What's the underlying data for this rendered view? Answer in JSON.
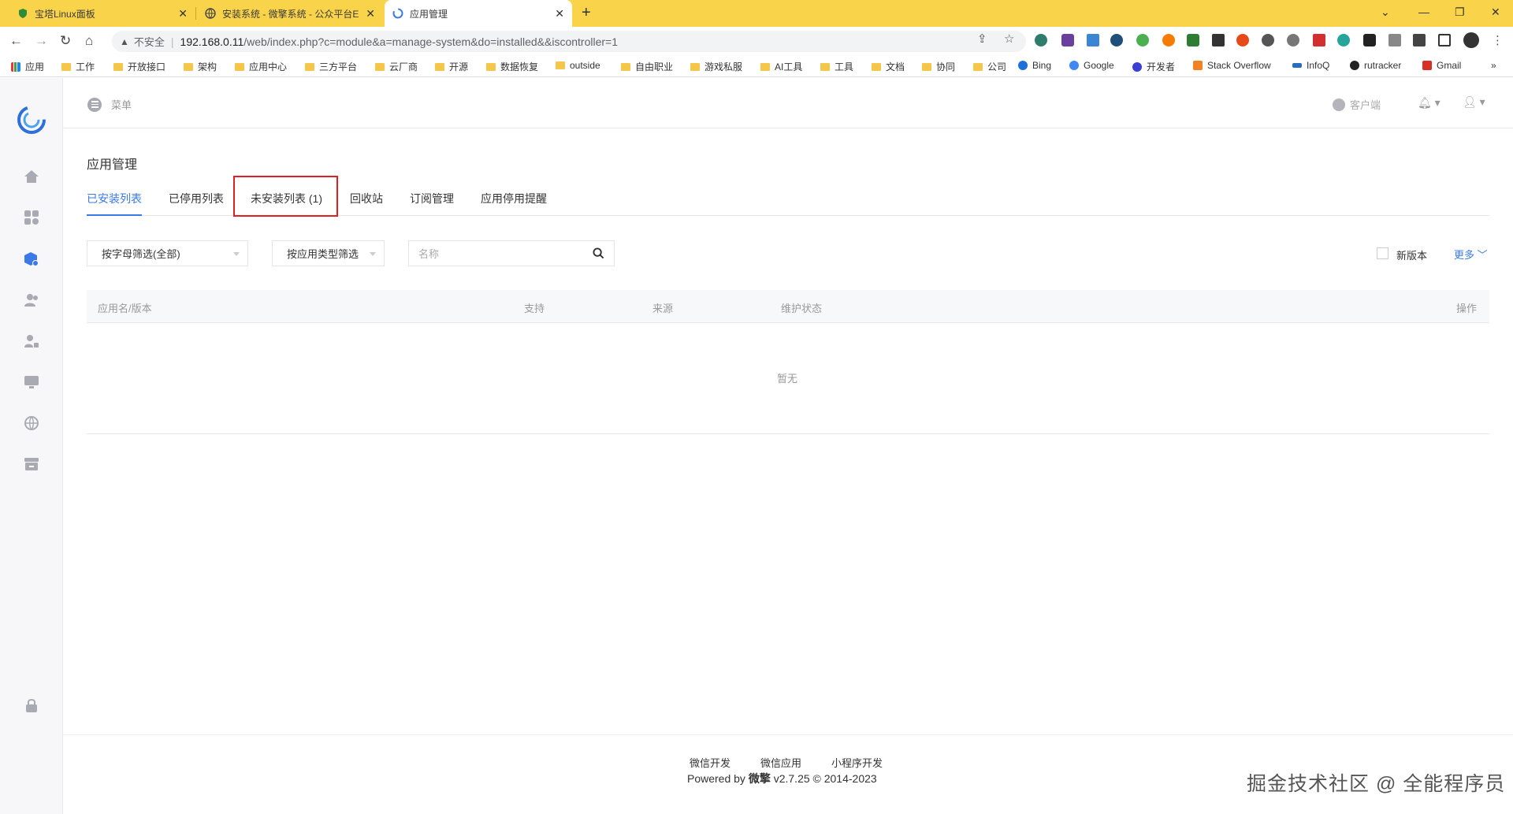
{
  "browser": {
    "tabs": [
      {
        "title": "宝塔Linux面板"
      },
      {
        "title": "安装系统 - 微擎系统 - 公众平台E"
      },
      {
        "title": "应用管理"
      }
    ],
    "address": {
      "insecure_label": "不安全",
      "url_host": "192.168.0.11",
      "url_path": "/web/index.php?c=module&a=manage-system&do=installed&&iscontroller=1"
    },
    "bookmarks": [
      {
        "label": "应用",
        "kind": "apps"
      },
      {
        "label": "工作",
        "kind": "folder"
      },
      {
        "label": "开放接口",
        "kind": "folder"
      },
      {
        "label": "架构",
        "kind": "folder"
      },
      {
        "label": "应用中心",
        "kind": "folder"
      },
      {
        "label": "三方平台",
        "kind": "folder"
      },
      {
        "label": "云厂商",
        "kind": "folder"
      },
      {
        "label": "开源",
        "kind": "folder"
      },
      {
        "label": "数据恢复",
        "kind": "folder"
      },
      {
        "label": "outside",
        "kind": "folder"
      },
      {
        "label": "自由职业",
        "kind": "folder"
      },
      {
        "label": "游戏私服",
        "kind": "folder"
      },
      {
        "label": "AI工具",
        "kind": "folder"
      },
      {
        "label": "工具",
        "kind": "folder"
      },
      {
        "label": "文档",
        "kind": "folder"
      },
      {
        "label": "协同",
        "kind": "folder"
      },
      {
        "label": "公司",
        "kind": "folder"
      },
      {
        "label": "Bing",
        "kind": "site"
      },
      {
        "label": "Google",
        "kind": "site"
      },
      {
        "label": "开发者",
        "kind": "site"
      },
      {
        "label": "Stack Overflow",
        "kind": "site"
      },
      {
        "label": "InfoQ",
        "kind": "site"
      },
      {
        "label": "rutracker",
        "kind": "site"
      },
      {
        "label": "Gmail",
        "kind": "site"
      }
    ],
    "bookmarks_overflow": "»"
  },
  "header": {
    "menu_label": "菜单",
    "client_label": "客户端"
  },
  "main": {
    "title": "应用管理",
    "tabs": [
      {
        "label": "已安装列表"
      },
      {
        "label": "已停用列表"
      },
      {
        "label": "未安装列表 (1)"
      },
      {
        "label": "回收站"
      },
      {
        "label": "订阅管理"
      },
      {
        "label": "应用停用提醒"
      }
    ],
    "filters": {
      "letter": "按字母筛选(全部)",
      "type": "按应用类型筛选",
      "search_placeholder": "名称",
      "new_version": "新版本",
      "more": "更多"
    },
    "table": {
      "columns": [
        "应用名/版本",
        "支持",
        "来源",
        "维护状态",
        "操作"
      ],
      "empty": "暂无"
    }
  },
  "footer": {
    "links": [
      "微信开发",
      "微信应用",
      "小程序开发"
    ],
    "powered_prefix": "Powered by ",
    "brand": "微擎",
    "powered_suffix": " v2.7.25 © 2014-2023"
  },
  "watermark": "掘金技术社区 @ 全能程序员",
  "colors": {
    "tabbar": "#f9d44a",
    "accent": "#3a79e6",
    "highlight_box": "#e02020"
  }
}
